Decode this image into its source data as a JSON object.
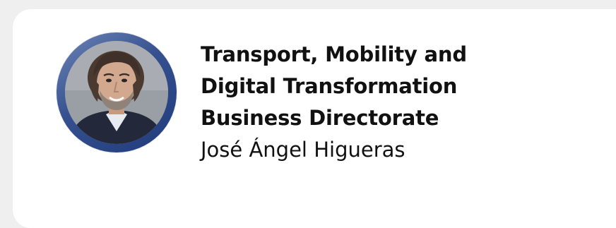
{
  "card": {
    "title_lines": [
      "Transport, Mobility and",
      "Digital Transformation",
      "Business Directorate"
    ],
    "name": "José Ángel Higueras"
  },
  "avatar": {
    "icon": "person-photo",
    "ring_color": "#2a4a8f"
  }
}
